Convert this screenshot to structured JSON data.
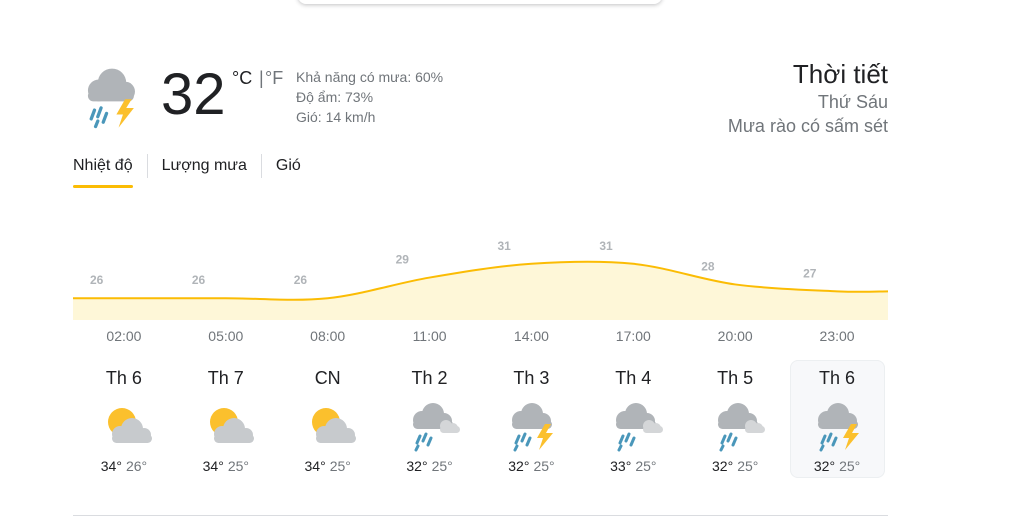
{
  "current": {
    "icon": "rain-thunder-icon",
    "temperature": "32",
    "unit_c": "°C",
    "unit_sep": "|",
    "unit_f": "°F",
    "precipitation": "Khả năng có mưa: 60%",
    "humidity": "Độ ẩm: 73%",
    "wind": "Gió: 14 km/h"
  },
  "location": {
    "title": "Thời tiết",
    "day": "Thứ Sáu",
    "description": "Mưa rào có sấm sét"
  },
  "tabs": [
    {
      "label": "Nhiệt độ",
      "active": true
    },
    {
      "label": "Lượng mưa",
      "active": false
    },
    {
      "label": "Gió",
      "active": false
    }
  ],
  "chart_data": {
    "type": "area",
    "x": [
      "02:00",
      "05:00",
      "08:00",
      "11:00",
      "14:00",
      "17:00",
      "20:00",
      "23:00"
    ],
    "values": [
      26,
      26,
      26,
      29,
      31,
      31,
      28,
      27
    ],
    "ylim": [
      24,
      33
    ],
    "line_color": "#fbbc04",
    "fill_color": "#fef7d8"
  },
  "days": [
    {
      "name": "Th 6",
      "icon": "partly-cloudy-icon",
      "hi": "34°",
      "lo": "26°",
      "selected": false
    },
    {
      "name": "Th 7",
      "icon": "partly-cloudy-icon",
      "hi": "34°",
      "lo": "25°",
      "selected": false
    },
    {
      "name": "CN",
      "icon": "partly-cloudy-icon",
      "hi": "34°",
      "lo": "25°",
      "selected": false
    },
    {
      "name": "Th 2",
      "icon": "rain-icon",
      "hi": "32°",
      "lo": "25°",
      "selected": false
    },
    {
      "name": "Th 3",
      "icon": "rain-thunder-icon",
      "hi": "32°",
      "lo": "25°",
      "selected": false
    },
    {
      "name": "Th 4",
      "icon": "rain-icon",
      "hi": "33°",
      "lo": "25°",
      "selected": false
    },
    {
      "name": "Th 5",
      "icon": "rain-icon",
      "hi": "32°",
      "lo": "25°",
      "selected": false
    },
    {
      "name": "Th 6",
      "icon": "rain-thunder-icon",
      "hi": "32°",
      "lo": "25°",
      "selected": true
    }
  ]
}
